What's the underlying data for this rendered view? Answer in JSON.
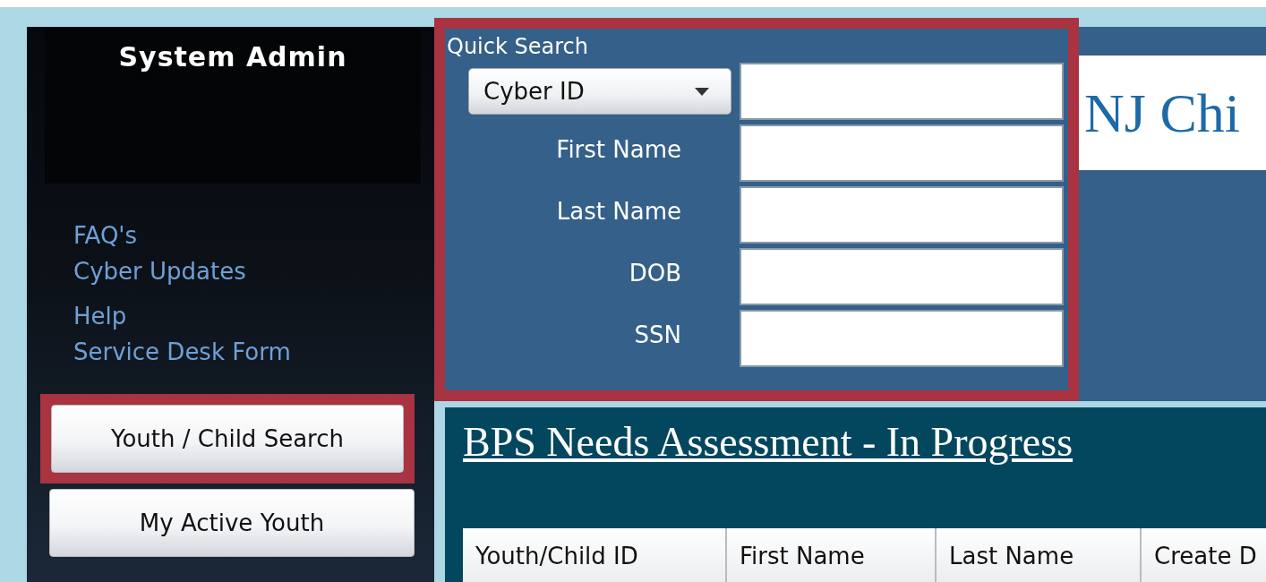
{
  "sidebar": {
    "user": "System Admin",
    "links": [
      "FAQ's",
      "Cyber Updates",
      "Help",
      "Service Desk Form"
    ],
    "buttons": [
      {
        "label": "Youth / Child Search",
        "highlighted": true
      },
      {
        "label": "My Active Youth",
        "highlighted": false
      }
    ]
  },
  "quick_search": {
    "title": "Quick Search",
    "highlighted": true,
    "search_by": {
      "value": "Cyber ID"
    },
    "fields": [
      {
        "label": "First Name"
      },
      {
        "label": "Last Name"
      },
      {
        "label": "DOB"
      },
      {
        "label": "SSN"
      }
    ]
  },
  "banner": {
    "title": "NJ Chi"
  },
  "section": {
    "title": "BPS Needs Assessment - In Progress",
    "table": {
      "columns": [
        "Youth/Child ID",
        "First Name",
        "Last Name",
        "Create D"
      ]
    }
  }
}
